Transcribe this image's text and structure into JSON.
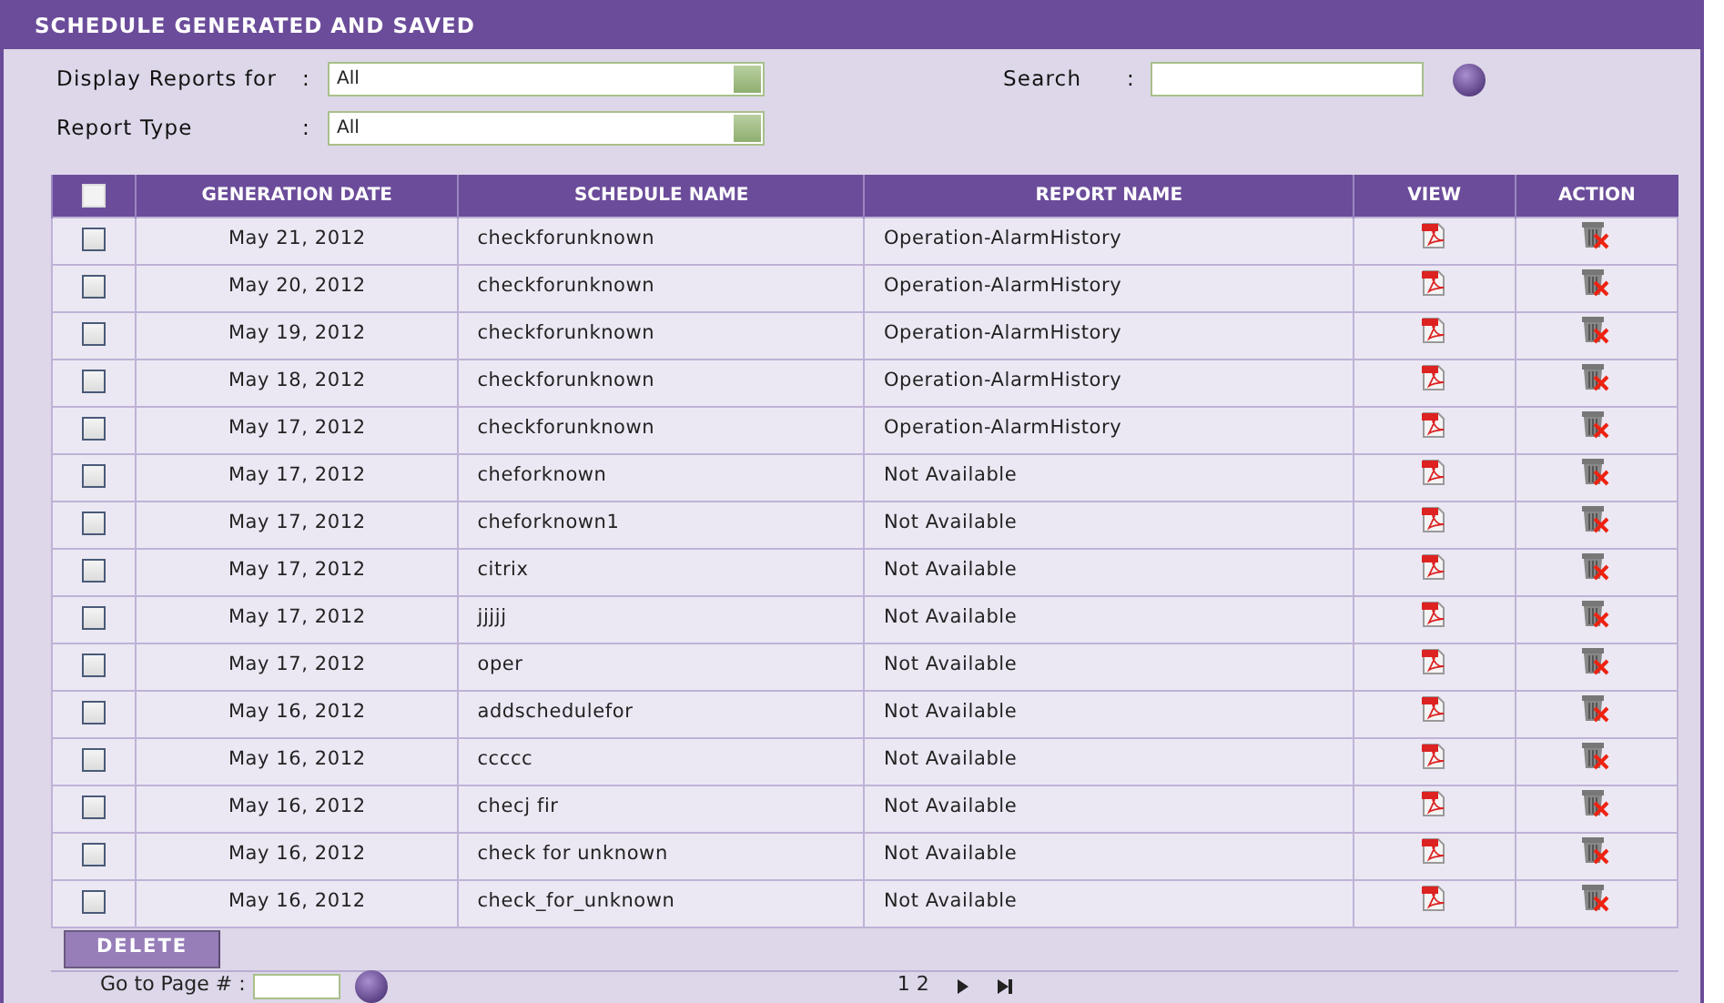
{
  "panel": {
    "title": "SCHEDULE GENERATED AND SAVED"
  },
  "filters": [
    {
      "label": "Display Reports for",
      "separator": ":",
      "value": "All"
    },
    {
      "label": "Report Type",
      "separator": ":",
      "value": "All"
    }
  ],
  "search": {
    "label": "Search",
    "separator": ":"
  },
  "table": {
    "select_all": {
      "checked": false
    },
    "columns": [
      "GENERATION DATE",
      "SCHEDULE NAME",
      "REPORT NAME",
      "VIEW",
      "ACTION"
    ],
    "rows": [
      {
        "checked": false,
        "date": "May 21, 2012",
        "schedule": "checkforunknown",
        "report": "Operation-AlarmHistory"
      },
      {
        "checked": false,
        "date": "May 20, 2012",
        "schedule": "checkforunknown",
        "report": "Operation-AlarmHistory"
      },
      {
        "checked": false,
        "date": "May 19, 2012",
        "schedule": "checkforunknown",
        "report": "Operation-AlarmHistory"
      },
      {
        "checked": false,
        "date": "May 18, 2012",
        "schedule": "checkforunknown",
        "report": "Operation-AlarmHistory"
      },
      {
        "checked": false,
        "date": "May 17, 2012",
        "schedule": "checkforunknown",
        "report": "Operation-AlarmHistory"
      },
      {
        "checked": false,
        "date": "May 17, 2012",
        "schedule": "cheforknown",
        "report": "Not Available"
      },
      {
        "checked": false,
        "date": "May 17, 2012",
        "schedule": "cheforknown1",
        "report": "Not Available"
      },
      {
        "checked": false,
        "date": "May 17, 2012",
        "schedule": "citrix",
        "report": "Not Available"
      },
      {
        "checked": false,
        "date": "May 17, 2012",
        "schedule": "jjjjj",
        "report": "Not Available"
      },
      {
        "checked": false,
        "date": "May 17, 2012",
        "schedule": "oper",
        "report": "Not Available"
      },
      {
        "checked": false,
        "date": "May 16, 2012",
        "schedule": "addschedulefor",
        "report": "Not Available"
      },
      {
        "checked": false,
        "date": "May 16, 2012",
        "schedule": "ccccc",
        "report": "Not Available"
      },
      {
        "checked": false,
        "date": "May 16, 2012",
        "schedule": "checj fir",
        "report": "Not Available"
      },
      {
        "checked": false,
        "date": "May 16, 2012",
        "schedule": "check for unknown",
        "report": "Not Available"
      },
      {
        "checked": false,
        "date": "May 16, 2012",
        "schedule": "check_for_unknown",
        "report": "Not Available"
      }
    ]
  },
  "delete_button": "DELETE",
  "pager": {
    "goto_label": "Go to Page # :",
    "pages": "1 2"
  }
}
